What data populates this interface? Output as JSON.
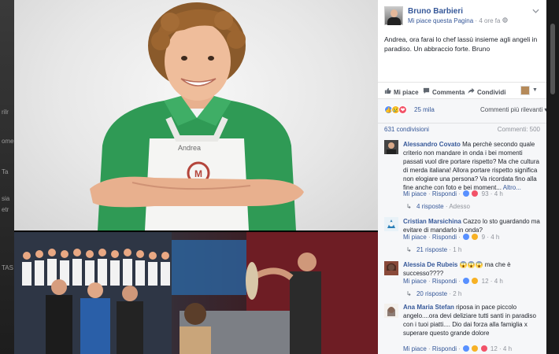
{
  "backdrop": {
    "fragments": [
      "rilr",
      "ome",
      "Ta",
      "sia",
      "etr",
      "TAS"
    ]
  },
  "photo": {
    "apron_name": "Andrea"
  },
  "post": {
    "page_name": "Bruno Barbieri",
    "like_page": "Mi piace questa Pagina",
    "separator": "·",
    "time": "4 ore fa",
    "time_icon": "globe-icon",
    "menu_icon": "chevron-down-icon",
    "text": "Andrea, ora farai lo chef lassù insieme agli angeli in paradiso. Un abbraccio forte. Bruno"
  },
  "actions": {
    "like": "Mi piace",
    "comment": "Commenta",
    "share": "Condividi",
    "like_icon": "thumbs-up-icon",
    "comment_icon": "speech-bubble-icon",
    "share_icon": "share-arrow-icon"
  },
  "reactions": {
    "count": "25 mila",
    "relevant": "Commenti più rilevanti",
    "relevant_caret": "▾"
  },
  "stats": {
    "shares": "631 condivisioni",
    "comments": "Commenti: 500"
  },
  "colors": {
    "link": "#365899",
    "like_blue": "#5890ff",
    "love_red": "#f25268",
    "sad_yellow": "#f7b125"
  },
  "comments": [
    {
      "author": "Alessandro Covato",
      "text": "Ma perchè secondo quale criterio non mandare in onda i bei momenti passati vuol dire portare rispetto? Ma che cultura di merda italiana! Allora portare rispetto significa non elogiare una persona? Va ricordata fino alla fine anche con foto e bei moment...",
      "more": "Altro...",
      "like": "Mi piace",
      "reply": "Rispondi",
      "reaction_count": "93",
      "time": "4 h",
      "replies": "4 risposte",
      "replies_time": "Adesso"
    },
    {
      "author": "Cristian Marsichina",
      "text": "Cazzo lo sto guardando ma evitare di mandarlo in onda?",
      "like": "Mi piace",
      "reply": "Rispondi",
      "reaction_count": "9",
      "time": "4 h",
      "replies": "21 risposte",
      "replies_time": "1 h"
    },
    {
      "author": "Alessia De Rubeis",
      "text": "😱😱😱 ma che è successo????",
      "like": "Mi piace",
      "reply": "Rispondi",
      "reaction_count": "12",
      "time": "4 h",
      "replies": "20 risposte",
      "replies_time": "2 h"
    },
    {
      "author": "Ana Maria Stefan",
      "text": "riposa in pace piccolo angelo....ora devi deliziare tutti santi in paradiso con i tuoi piatti.... Dio dai forza alla famiglia x superare questo grande dolore",
      "like": "Mi piace",
      "reply": "Rispondi",
      "reaction_count": "12",
      "time": "4 h"
    }
  ]
}
